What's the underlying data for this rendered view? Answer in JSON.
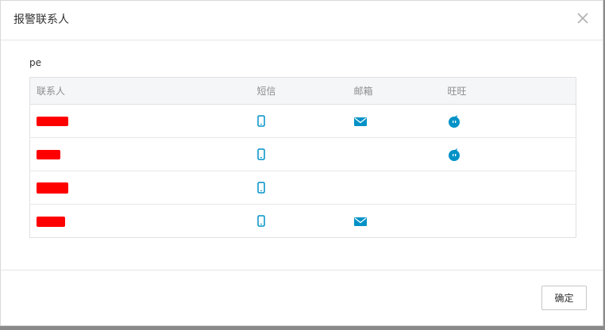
{
  "modal": {
    "title": "报警联系人",
    "close_icon": "close-icon"
  },
  "group": {
    "name": "pe"
  },
  "table": {
    "columns": [
      "联系人",
      "短信",
      "邮箱",
      "旺旺"
    ],
    "rows": [
      {
        "name_redacted": true,
        "sms": true,
        "email": true,
        "wangwang": true
      },
      {
        "name_redacted": true,
        "sms": true,
        "email": false,
        "wangwang": true
      },
      {
        "name_redacted": true,
        "sms": true,
        "email": false,
        "wangwang": false
      },
      {
        "name_redacted": true,
        "sms": true,
        "email": true,
        "wangwang": false
      }
    ]
  },
  "icons": {
    "sms": "mobile-phone-icon",
    "email": "envelope-icon",
    "wangwang": "wangwang-chat-icon"
  },
  "colors": {
    "icon_accent": "#0092c7",
    "redaction": "#ff0000",
    "header_bg": "#f5f6f8"
  },
  "footer": {
    "ok_label": "确定"
  }
}
